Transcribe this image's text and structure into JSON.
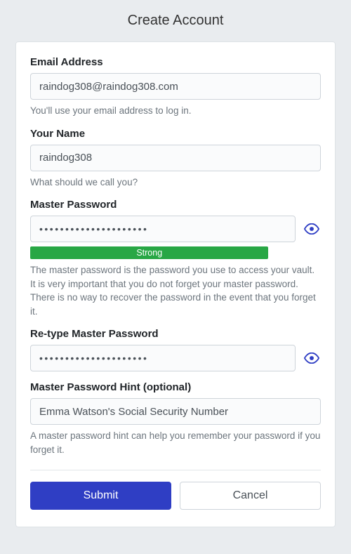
{
  "page_title": "Create Account",
  "email": {
    "label": "Email Address",
    "value": "raindog308@raindog308.com",
    "help": "You'll use your email address to log in."
  },
  "name": {
    "label": "Your Name",
    "value": "raindog308",
    "help": "What should we call you?"
  },
  "master_password": {
    "label": "Master Password",
    "mask": "•••••••••••••••••••••",
    "strength_label": "Strong",
    "strength_color": "#28a745",
    "help": "The master password is the password you use to access your vault. It is very important that you do not forget your master password. There is no way to recover the password in the event that you forget it."
  },
  "retype_password": {
    "label": "Re-type Master Password",
    "mask": "•••••••••••••••••••••"
  },
  "hint": {
    "label": "Master Password Hint (optional)",
    "value": "Emma Watson's Social Security Number",
    "help": "A master password hint can help you remember your password if you forget it."
  },
  "buttons": {
    "submit": "Submit",
    "cancel": "Cancel"
  },
  "colors": {
    "primary": "#2f3ec4"
  }
}
